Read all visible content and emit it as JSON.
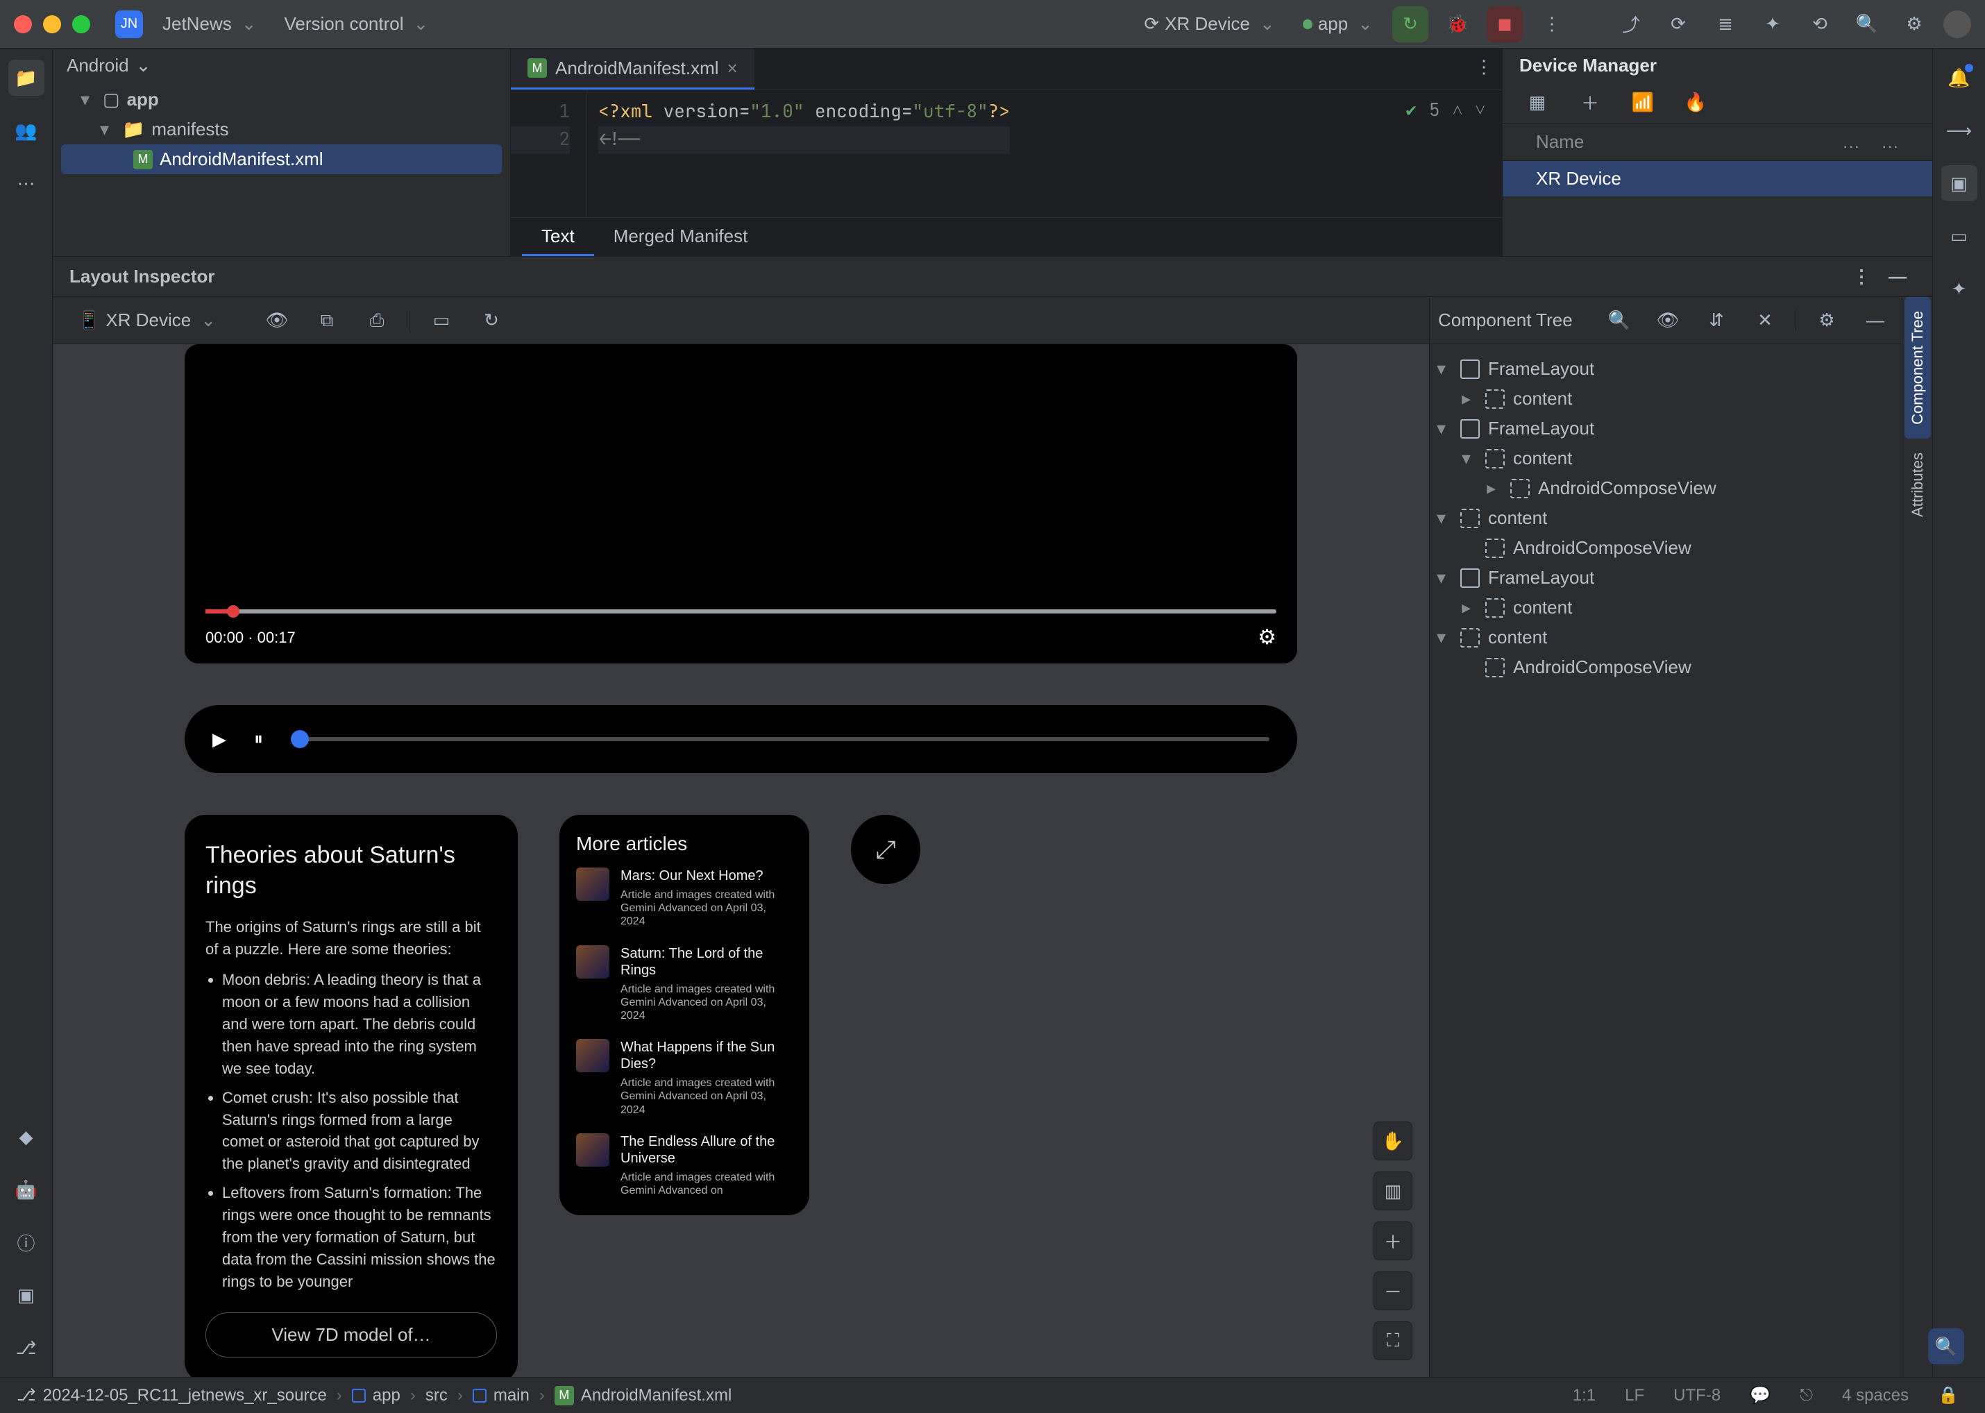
{
  "titlebar": {
    "project_name": "JetNews",
    "vcs_label": "Version control",
    "device_target": "XR Device",
    "run_config": "app"
  },
  "project_pane": {
    "view_label": "Android",
    "root": "app",
    "manifests": "manifests",
    "manifest_file": "AndroidManifest.xml"
  },
  "editor": {
    "tab_file": "AndroidManifest.xml",
    "line1_xml": "<?xml",
    "line1_version_attr": " version=",
    "line1_version_val": "\"1.0\"",
    "line1_encoding_attr": " encoding=",
    "line1_encoding_val": "\"utf-8\"",
    "line1_close": "?>",
    "line2": "<!--",
    "problems_count": "5",
    "bottom_tabs": {
      "text": "Text",
      "merged": "Merged Manifest"
    }
  },
  "device_manager": {
    "title": "Device Manager",
    "col_name": "Name",
    "device": "XR Device"
  },
  "inspector": {
    "title": "Layout Inspector",
    "device_select": "XR Device",
    "ctree_title": "Component Tree"
  },
  "preview": {
    "video": {
      "time_current": "00:00",
      "time_sep": "  ·  ",
      "time_total": "00:17"
    },
    "theory": {
      "title": "Theories about Saturn's rings",
      "intro": "The origins of Saturn's rings are still a bit of a puzzle. Here are some theories:",
      "bullets": [
        "Moon debris: A leading theory is that a moon or a few moons had a collision and were torn apart. The debris could then have spread into the ring system we see today.",
        "Comet crush: It's also possible that Saturn's rings formed from a large comet or asteroid that got captured by the planet's gravity and disintegrated",
        "Leftovers from Saturn's formation: The rings were once thought to be remnants from the very formation of Saturn, but data from the Cassini mission shows the rings to be younger"
      ],
      "button": "View 7D model of…"
    },
    "more": {
      "title": "More articles",
      "articles": [
        {
          "title": "Mars: Our Next Home?",
          "meta": "Article and images created with Gemini Advanced on April 03, 2024"
        },
        {
          "title": "Saturn: The Lord of the Rings",
          "meta": "Article and images created with Gemini Advanced on April 03, 2024"
        },
        {
          "title": "What Happens if the Sun Dies?",
          "meta": "Article and images created with Gemini Advanced on April 03, 2024"
        },
        {
          "title": "The Endless Allure of the Universe",
          "meta": "Article and images created with Gemini Advanced on"
        }
      ]
    }
  },
  "ctree": {
    "items": [
      {
        "label": "FrameLayout",
        "indent": 1,
        "exp": "▾",
        "type": "frame"
      },
      {
        "label": "content",
        "indent": 2,
        "exp": "▸",
        "type": "content"
      },
      {
        "label": "FrameLayout",
        "indent": 1,
        "exp": "▾",
        "type": "frame"
      },
      {
        "label": "content",
        "indent": 2,
        "exp": "▾",
        "type": "content"
      },
      {
        "label": "AndroidComposeView",
        "indent": 3,
        "exp": "▸",
        "type": "content"
      },
      {
        "label": "content",
        "indent": 1,
        "exp": "▾",
        "type": "content"
      },
      {
        "label": "AndroidComposeView",
        "indent": 2,
        "exp": "",
        "type": "content"
      },
      {
        "label": "FrameLayout",
        "indent": 1,
        "exp": "▾",
        "type": "frame"
      },
      {
        "label": "content",
        "indent": 2,
        "exp": "▸",
        "type": "content"
      },
      {
        "label": "content",
        "indent": 1,
        "exp": "▾",
        "type": "content"
      },
      {
        "label": "AndroidComposeView",
        "indent": 2,
        "exp": "",
        "type": "content"
      }
    ]
  },
  "side_tabs": {
    "components": "Component Tree",
    "attributes": "Attributes"
  },
  "breadcrumb": {
    "branch": "2024-12-05_RC11_jetnews_xr_source",
    "segs": [
      "app",
      "src",
      "main",
      "AndroidManifest.xml"
    ]
  },
  "statusbar": {
    "pos": "1:1",
    "eol": "LF",
    "enc": "UTF-8",
    "indent": "4 spaces"
  }
}
